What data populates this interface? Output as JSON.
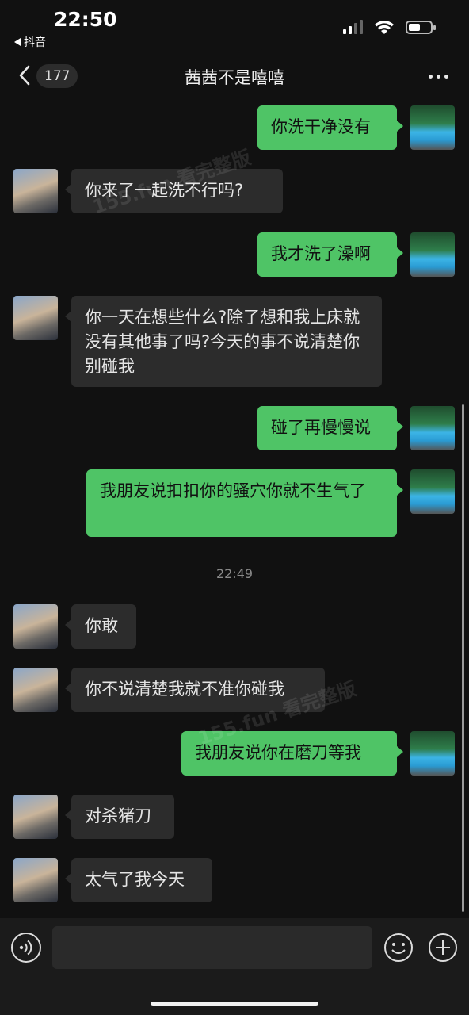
{
  "status_bar": {
    "time": "22:50",
    "back_app_label": "抖音",
    "battery_level": 0.55,
    "signal_bars": 2
  },
  "nav": {
    "unread_count": "177",
    "title": "茜茜不是嘻嘻"
  },
  "messages": [
    {
      "side": "out",
      "text": "你洗干净没有"
    },
    {
      "side": "in",
      "text": "你来了一起洗不行吗?"
    },
    {
      "side": "out",
      "text": "我才洗了澡啊"
    },
    {
      "side": "in",
      "text": "你一天在想些什么?除了想和我上床就没有其他事了吗?今天的事不说清楚你别碰我"
    },
    {
      "side": "out",
      "text": "碰了再慢慢说"
    },
    {
      "side": "out",
      "text": "我朋友说扣扣你的骚穴你就不生气了"
    },
    {
      "side": "in",
      "text": "你敢"
    },
    {
      "side": "in",
      "text": "你不说清楚我就不准你碰我"
    },
    {
      "side": "out",
      "text": "我朋友说你在磨刀等我"
    },
    {
      "side": "in",
      "text": "对杀猪刀"
    },
    {
      "side": "in",
      "text": "太气了我今天"
    }
  ],
  "timestamp": "22:49",
  "watermark": {
    "text_1": "155.fun 看完整版",
    "text_2": "155.fun 看完整版"
  },
  "input": {
    "value": "",
    "placeholder": ""
  },
  "colors": {
    "background": "#111111",
    "outgoing_bubble": "#4fc466",
    "incoming_bubble": "#2c2c2c"
  }
}
